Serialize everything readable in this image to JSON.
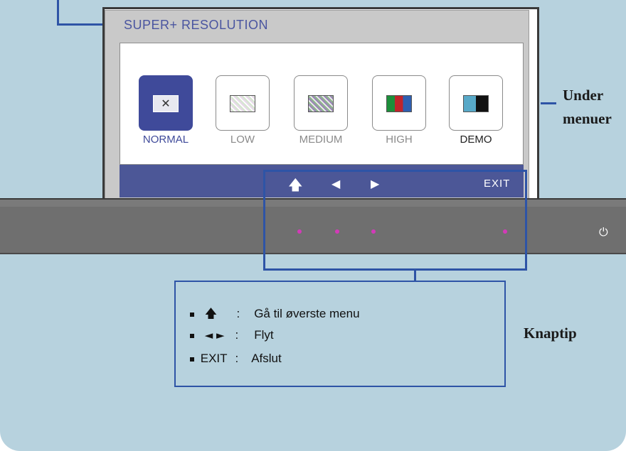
{
  "osd": {
    "title": "SUPER+ RESOLUTION",
    "options": [
      {
        "label": "NORMAL",
        "selected": true,
        "icon": "normal-mode-icon"
      },
      {
        "label": "LOW",
        "selected": false,
        "icon": "low-mode-icon"
      },
      {
        "label": "MEDIUM",
        "selected": false,
        "icon": "medium-mode-icon"
      },
      {
        "label": "HIGH",
        "selected": false,
        "icon": "high-mode-icon"
      },
      {
        "label": "DEMO",
        "selected": false,
        "icon": "demo-mode-icon"
      }
    ],
    "bar": {
      "up": "🡅",
      "left": "◀",
      "right": "▶",
      "exit": "EXIT"
    }
  },
  "callouts": {
    "submenu": "Under\nmenuer",
    "buttons": "Knaptip"
  },
  "tips": [
    {
      "key": "🡅",
      "sep": ":",
      "text": "Gå til øverste menu"
    },
    {
      "key": "◄ ►",
      "sep": ":",
      "text": "Flyt"
    },
    {
      "key": "EXIT",
      "sep": ":",
      "text": "Afslut"
    }
  ],
  "colors": {
    "accent": "#2e54a6",
    "osd_bar": "#4c5797",
    "led": "#d33ab8",
    "background": "#b7d2de"
  }
}
